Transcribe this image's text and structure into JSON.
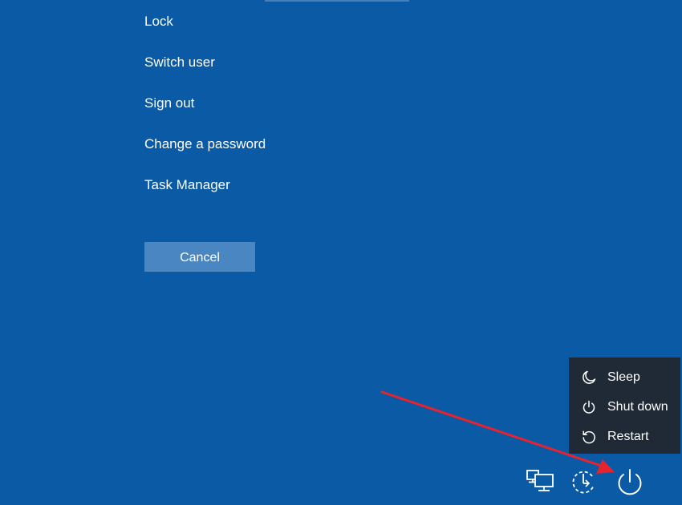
{
  "menu": {
    "items": [
      {
        "label": "Lock"
      },
      {
        "label": "Switch user"
      },
      {
        "label": "Sign out"
      },
      {
        "label": "Change a password"
      },
      {
        "label": "Task Manager"
      }
    ]
  },
  "cancel_label": "Cancel",
  "power_menu": {
    "items": [
      {
        "label": "Sleep",
        "icon": "moon-icon"
      },
      {
        "label": "Shut down",
        "icon": "power-icon"
      },
      {
        "label": "Restart",
        "icon": "restart-icon"
      }
    ]
  },
  "tray": {
    "icons": [
      "network-icon",
      "accessibility-icon",
      "power-icon"
    ]
  },
  "colors": {
    "background": "#0a5aa6",
    "button": "#4a86c2",
    "flyout": "#1f2a36",
    "annotation_arrow": "#e8232e"
  }
}
